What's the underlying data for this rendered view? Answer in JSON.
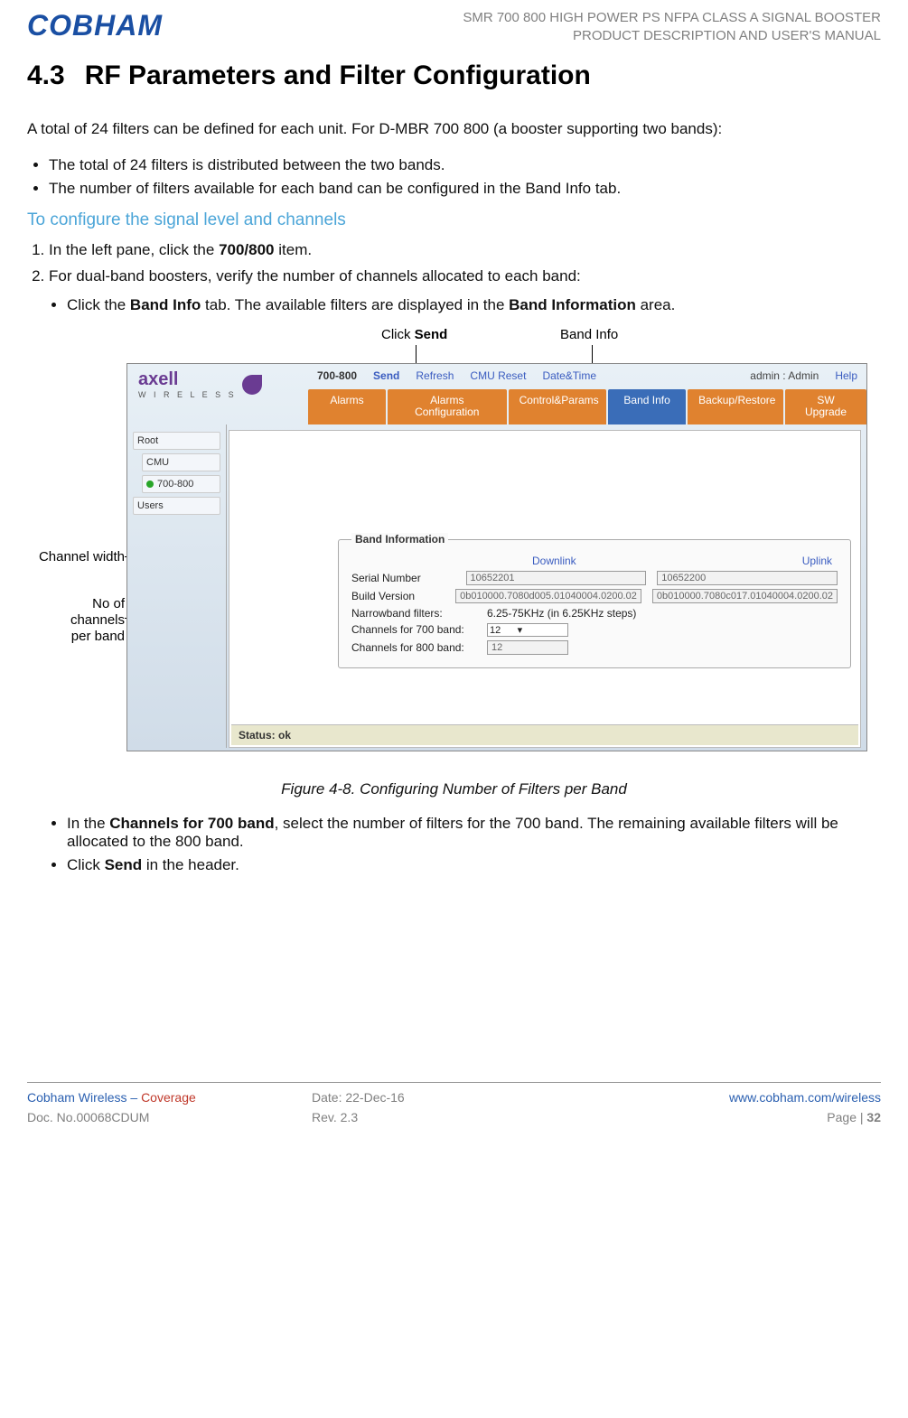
{
  "header": {
    "logo": "COBHAM",
    "title1": "SMR 700 800 HIGH POWER PS NFPA CLASS A SIGNAL BOOSTER",
    "title2": "PRODUCT DESCRIPTION AND USER'S MANUAL"
  },
  "section": {
    "number": "4.3",
    "title": "RF Parameters and Filter Configuration"
  },
  "intro": "A total of 24 filters can be defined for each unit. For D-MBR 700 800 (a booster supporting two bands):",
  "intro_bullets": [
    "The total of 24 filters is distributed between the two bands.",
    "The number of filters available for each band can be configured in the Band Info tab."
  ],
  "subhead": "To configure the signal level and channels",
  "steps": {
    "s1_pre": "In the left pane, click the ",
    "s1_strong": "700/800",
    "s1_post": " item.",
    "s2": "For dual-band boosters, verify the number of channels allocated to each band:",
    "s2b1_pre": "Click the ",
    "s2b1_strong": "Band Info",
    "s2b1_mid": " tab. The available filters are displayed in the ",
    "s2b1_strong2": "Band Information",
    "s2b1_post": " area."
  },
  "callouts": {
    "send_pre": "Click ",
    "send_strong": "Send",
    "band_info": "Band Info",
    "channel_width": "Channel width",
    "no_channels_l1": "No of",
    "no_channels_l2": "channels",
    "no_channels_l3": "per band"
  },
  "screenshot": {
    "logo": "axell",
    "logo_sub": "W I R E L E S S",
    "top_label": "700-800",
    "top_links": [
      "Send",
      "Refresh",
      "CMU Reset",
      "Date&Time"
    ],
    "top_right_admin": "admin : Admin",
    "top_right_help": "Help",
    "tabs": [
      "Alarms",
      "Alarms Configuration",
      "Control&Params",
      "Band Info",
      "Backup/Restore",
      "SW Upgrade"
    ],
    "active_tab": 3,
    "tree": {
      "root": "Root",
      "cmu": "CMU",
      "band": "700-800",
      "users": "Users"
    },
    "panel_title": "Band Information",
    "col_dl": "Downlink",
    "col_ul": "Uplink",
    "rows": {
      "serial_label": "Serial Number",
      "serial_dl": "10652201",
      "serial_ul": "10652200",
      "build_label": "Build Version",
      "build_dl": "0b010000.7080d005.01040004.0200.02",
      "build_ul": "0b010000.7080c017.01040004.0200.02",
      "nb_label": "Narrowband filters:",
      "nb_val": "6.25-75KHz (in 6.25KHz steps)",
      "ch700_label": "Channels for 700 band:",
      "ch700_val": "12",
      "ch800_label": "Channels for 800 band:",
      "ch800_val": "12"
    },
    "status": "Status: ok"
  },
  "figure_caption": "Figure 4-8. Configuring Number of Filters per Band",
  "after_bullets": {
    "b1_pre": "In the ",
    "b1_strong": "Channels for 700 band",
    "b1_post": ", select the number of filters for the 700 band. The remaining available filters will be allocated to the 800 band.",
    "b2_pre": "Click ",
    "b2_strong": "Send",
    "b2_post": " in the header."
  },
  "footer": {
    "brand": "Cobham Wireless",
    "dash": " – ",
    "coverage": "Coverage",
    "date": "Date: 22-Dec-16",
    "url": "www.cobham.com/wireless",
    "doc": "Doc. No.00068CDUM",
    "rev": "Rev. 2.3",
    "page_pre": "Page | ",
    "page_num": "32"
  }
}
